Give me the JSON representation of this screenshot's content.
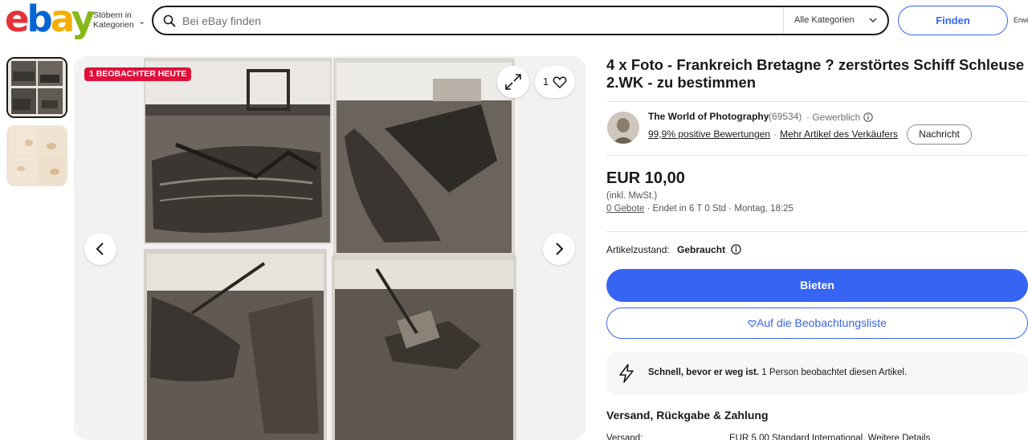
{
  "header": {
    "logo_letters": [
      "e",
      "b",
      "a",
      "y"
    ],
    "browse_label": "Stöbern in Kategorien",
    "search_placeholder": "Bei eBay finden",
    "category_select": "Alle Kategorien",
    "find_label": "Finden",
    "advanced_label": "Erwe"
  },
  "gallery": {
    "badge": "1 BEOBACHTER HEUTE",
    "watch_count": "1",
    "thumbnails": [
      "photo-thumbnail-front",
      "photo-thumbnail-back"
    ]
  },
  "listing": {
    "title": "4 x Foto - Frankreich Bretagne ? zerstörtes Schiff Schleuse 2.WK - zu bestimmen",
    "seller": {
      "name": "The World of Photography",
      "feedback_count": "(69534)",
      "type": "· Gewerblich",
      "positive": "99,9% positive Bewertungen",
      "more_items": "Mehr Artikel des Verkäufers",
      "message_label": "Nachricht"
    },
    "price": "EUR 10,00",
    "tax_note": "(inkl. MwSt.)",
    "bids": "0 Gebote",
    "ends": "· Endet in 6 T 0 Std · Montag, 18:25",
    "condition_label": "Artikelzustand:",
    "condition_value": "Gebraucht",
    "bid_button": "Bieten",
    "watchlist_button": "Auf die Beobachtungsliste",
    "promo_bold": "Schnell, bevor er weg ist.",
    "promo_text": " 1 Person beobachtet diesen Artikel.",
    "shipping_title": "Versand, Rückgabe & Zahlung",
    "shipping_label": "Versand:",
    "shipping_value": "EUR 5,00 Standard International. Weitere Details"
  },
  "colors": {
    "brand_blue": "#3665f3",
    "badge_red": "#e0103a",
    "logo_red": "#e53238",
    "logo_blue": "#0064d2",
    "logo_yellow": "#f5af02",
    "logo_green": "#86b817"
  }
}
